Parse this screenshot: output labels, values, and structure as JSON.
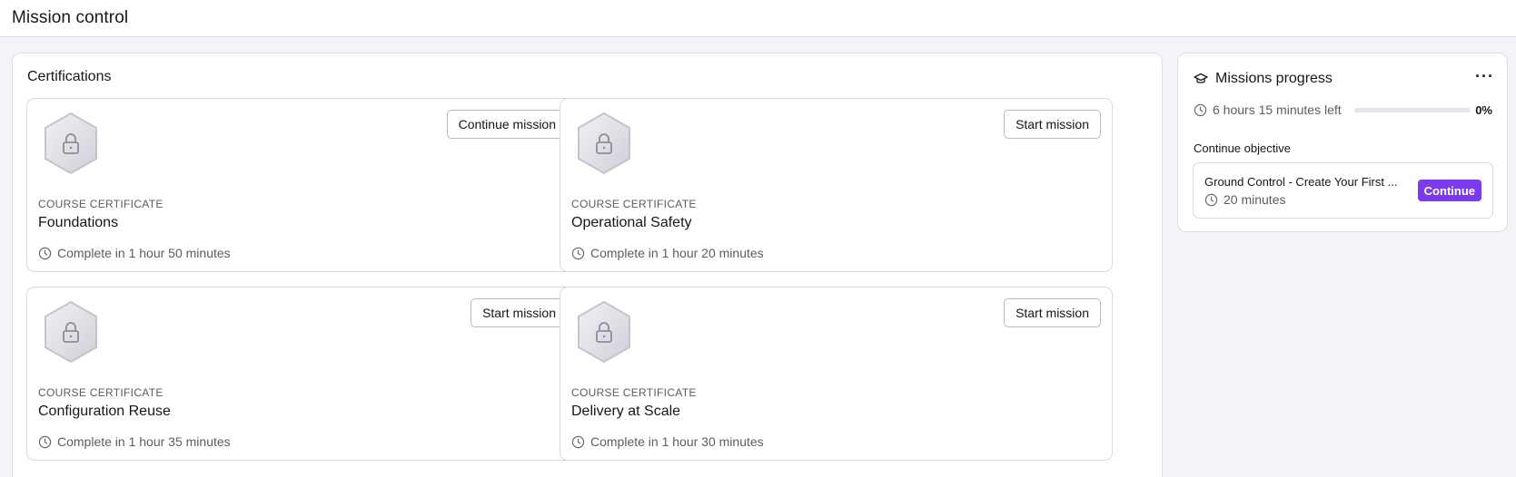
{
  "header": {
    "title": "Mission control"
  },
  "certifications": {
    "title": "Certifications",
    "items": [
      {
        "kicker": "COURSE CERTIFICATE",
        "title": "Foundations",
        "duration": "Complete in 1 hour 50 minutes",
        "button": "Continue mission",
        "locked": true
      },
      {
        "kicker": "COURSE CERTIFICATE",
        "title": "Operational Safety",
        "duration": "Complete in 1 hour 20 minutes",
        "button": "Start mission",
        "locked": true
      },
      {
        "kicker": "COURSE CERTIFICATE",
        "title": "Configuration Reuse",
        "duration": "Complete in 1 hour 35 minutes",
        "button": "Start mission",
        "locked": true
      },
      {
        "kicker": "COURSE CERTIFICATE",
        "title": "Delivery at Scale",
        "duration": "Complete in 1 hour 30 minutes",
        "button": "Start mission",
        "locked": true
      }
    ]
  },
  "progress": {
    "title": "Missions progress",
    "time_left": "6 hours 15 minutes left",
    "percent_label": "0%",
    "percent": 0,
    "objective_label": "Continue objective",
    "objective": {
      "title": "Ground Control - Create Your First ...",
      "duration": "20 minutes",
      "button": "Continue"
    }
  },
  "colors": {
    "accent": "#7c3aed",
    "track": "#e4e4ee"
  },
  "icons": {
    "badge": "lock-hexagon-icon",
    "clock": "clock-icon",
    "progress": "graduation-cap-icon",
    "menu": "more-horizontal-icon"
  }
}
